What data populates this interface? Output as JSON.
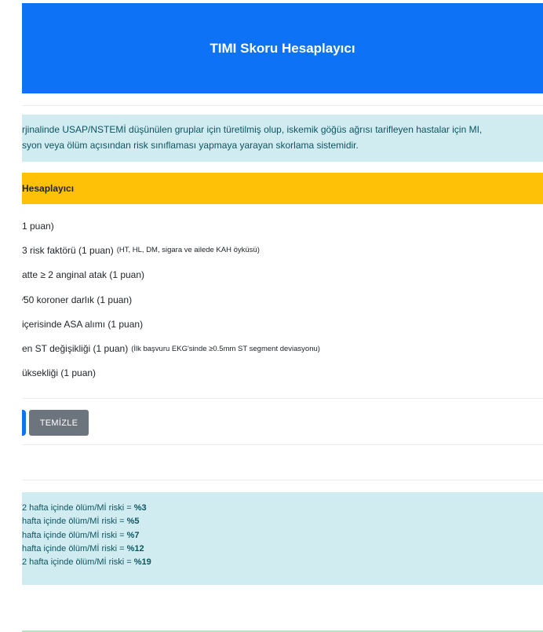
{
  "header": {
    "title": "TIMI Skoru Hesaplayıcı"
  },
  "info": {
    "line1": "rjinalinde USAP/NSTEMİ düşünülen gruplar için türetilmiş olup, iskemik göğüs ağrısı tarifleyen hastalar için MI,",
    "line2": "syon veya ölüm açısından risk sınıflaması yapmaya yarayan skorlama sistemidir."
  },
  "calculator": {
    "header": "Hesaplayıcı",
    "criteria": [
      {
        "label": "1 puan)",
        "note": ""
      },
      {
        "label": "3 risk faktörü (1 puan)",
        "note": "(HT, HL, DM, sigara ve ailede KAH öyküsü)"
      },
      {
        "label": "atte ≥ 2 anginal atak (1 puan)",
        "note": ""
      },
      {
        "label": "⁄50 koroner darlık (1 puan)",
        "note": ""
      },
      {
        "label": "içerisinde ASA alımı (1 puan)",
        "note": ""
      },
      {
        "label": "en ST değişikliği (1 puan)",
        "note": "(İlk başvuru EKG'sinde ≥0.5mm ST segment deviasyonu)"
      },
      {
        "label": "üksekliği (1 puan)",
        "note": ""
      }
    ],
    "clear_label": "TEMİZLE"
  },
  "risks": [
    {
      "text": "2 hafta içinde ölüm/Mİ riski = ",
      "value": "%3"
    },
    {
      "text": "hafta içinde ölüm/Mİ riski = ",
      "value": "%5"
    },
    {
      "text": "hafta içinde ölüm/Mİ riski = ",
      "value": "%7"
    },
    {
      "text": "hafta içinde ölüm/Mİ riski = ",
      "value": "%12"
    },
    {
      "text": "2 hafta içinde ölüm/Mİ riski = ",
      "value": "%19"
    }
  ],
  "colors": {
    "header": "#0d72f5",
    "warning": "#ffc107",
    "info_bg": "#d1ecf1",
    "info_text": "#0c5460",
    "secondary": "#6c757d"
  }
}
